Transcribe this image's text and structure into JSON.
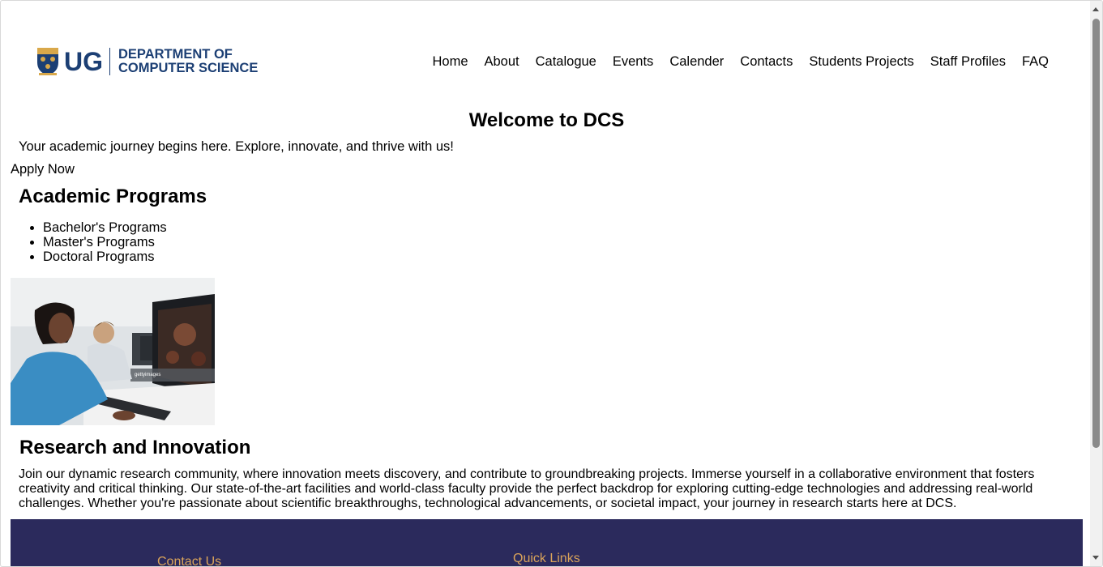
{
  "header": {
    "logo_text": "UG",
    "dept_line1": "DEPARTMENT OF",
    "dept_line2": "COMPUTER SCIENCE",
    "nav": [
      "Home",
      "About",
      "Catalogue",
      "Events",
      "Calender",
      "Contacts",
      "Students Projects",
      "Staff Profiles",
      "FAQ"
    ]
  },
  "hero": {
    "title": "Welcome to DCS",
    "tagline": "Your academic journey begins here. Explore, innovate, and thrive with us!",
    "apply_label": "Apply Now"
  },
  "programs": {
    "heading": "Academic Programs",
    "items": [
      "Bachelor's Programs",
      "Master's Programs",
      "Doctoral Programs"
    ]
  },
  "photo": {
    "watermark": "gettyimages"
  },
  "research": {
    "heading": "Research and Innovation",
    "body": "Join our dynamic research community, where innovation meets discovery, and contribute to groundbreaking projects. Immerse yourself in a collaborative environment that fosters creativity and critical thinking. Our state-of-the-art facilities and world-class faculty provide the perfect backdrop for exploring cutting-edge technologies and addressing real-world challenges. Whether you're passionate about scientific breakthroughs, technological advancements, or societal impact, your journey in research starts here at DCS."
  },
  "footer": {
    "contact_heading": "Contact Us",
    "quick_links_heading": "Quick Links"
  },
  "colors": {
    "brand_blue": "#1c3f74",
    "footer_bg": "#2b2a5c",
    "footer_heading": "#d9a35a"
  }
}
